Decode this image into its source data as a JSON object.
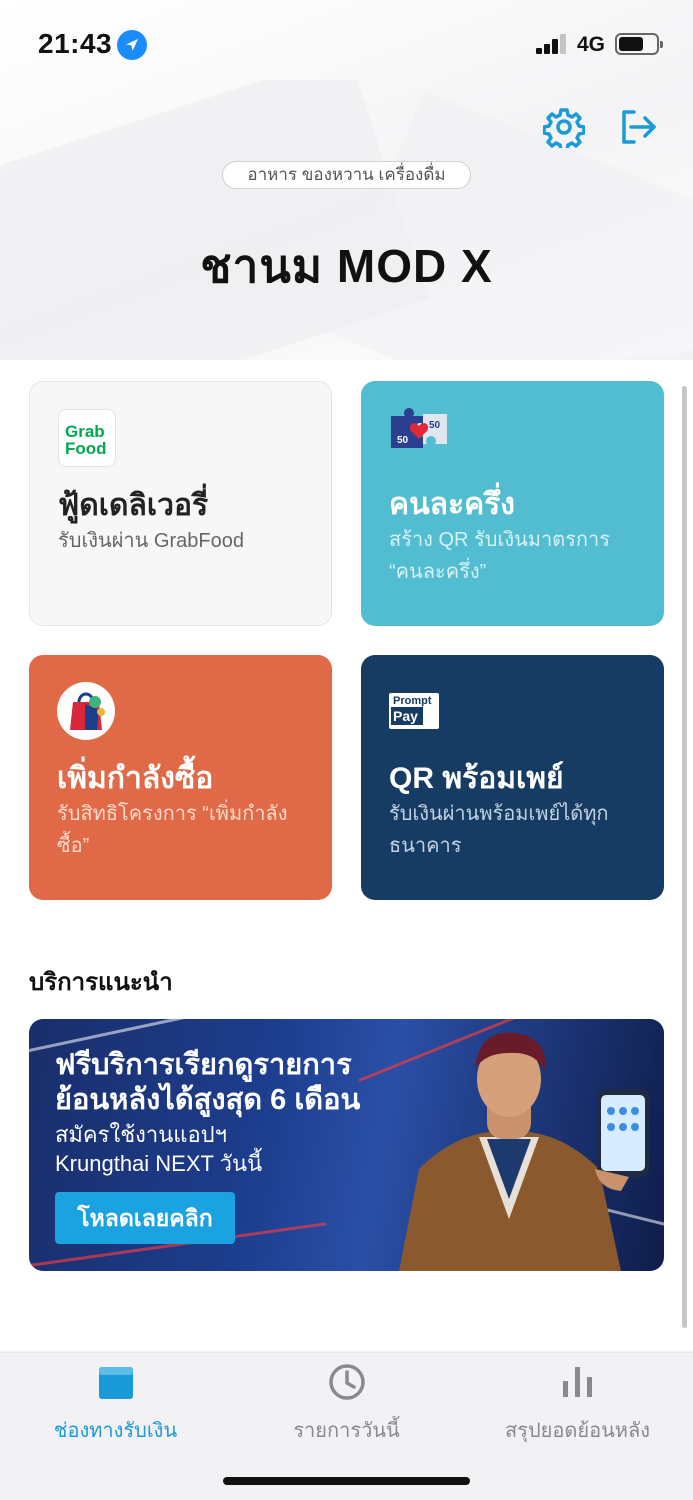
{
  "status": {
    "time": "21:43",
    "network": "4G"
  },
  "header": {
    "category": "อาหาร ของหวาน เครื่องดื่ม",
    "shop_name": "ชานม MOD X"
  },
  "cards": [
    {
      "title": "ฟู้ดเดลิเวอรี่",
      "subtitle": "รับเงินผ่าน GrabFood",
      "logo_text_1": "Grab",
      "logo_text_2": "Food"
    },
    {
      "title": "คนละครึ่ง",
      "subtitle": "สร้าง QR รับเงินมาตรการ “คนละครึ่ง”",
      "logo_num_1": "50",
      "logo_num_2": "50"
    },
    {
      "title": "เพิ่มกำลังซื้อ",
      "subtitle": "รับสิทธิโครงการ “เพิ่มกำลังซื้อ”"
    },
    {
      "title": "QR พร้อมเพย์",
      "subtitle": "รับเงินผ่านพร้อมเพย์ได้ทุกธนาคาร",
      "logo_text_1": "Prompt",
      "logo_text_2": "Pay"
    }
  ],
  "section": {
    "title": "บริการแนะนำ"
  },
  "banner": {
    "headline_1": "ฟรีบริการเรียกดูรายการ",
    "headline_2": "ย้อนหลังได้สูงสุด 6 เดือน",
    "sub_1": "สมัครใช้งานแอปฯ",
    "sub_2": "Krungthai NEXT วันนี้",
    "button": "โหลดเลยคลิก"
  },
  "tabs": [
    {
      "label": "ช่องทางรับเงิน",
      "icon": "wallet-icon",
      "active": true
    },
    {
      "label": "รายการวันนี้",
      "icon": "clock-icon",
      "active": false
    },
    {
      "label": "สรุปยอดย้อนหลัง",
      "icon": "bar-chart-icon",
      "active": false
    }
  ],
  "colors": {
    "accent": "#1a9ad6",
    "half_half_card": "#52bdd0",
    "power_card": "#e06a47",
    "promptpay_card": "#173c63"
  }
}
